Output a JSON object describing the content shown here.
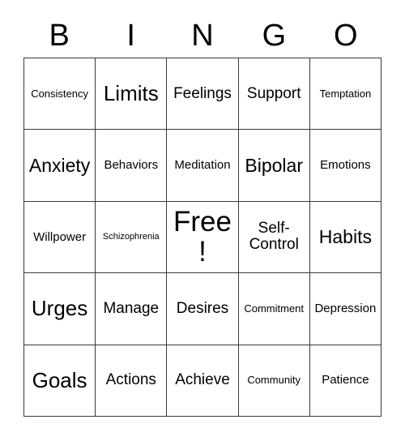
{
  "card": {
    "header_letters": [
      "B",
      "I",
      "N",
      "G",
      "O"
    ],
    "columns": 5,
    "rows": 5,
    "border_color": "#3a3a3a",
    "background_color": "#ffffff",
    "text_color": "#000000",
    "free_space": {
      "row": 3,
      "column": 3,
      "label": "Free!"
    },
    "cells": [
      {
        "text": "Consistency",
        "size": "s"
      },
      {
        "text": "Limits",
        "size": "xxl"
      },
      {
        "text": "Feelings",
        "size": "l"
      },
      {
        "text": "Support",
        "size": "l"
      },
      {
        "text": "Temptation",
        "size": "s"
      },
      {
        "text": "Anxiety",
        "size": "xl"
      },
      {
        "text": "Behaviors",
        "size": "m"
      },
      {
        "text": "Meditation",
        "size": "m"
      },
      {
        "text": "Bipolar",
        "size": "xl"
      },
      {
        "text": "Emotions",
        "size": "m"
      },
      {
        "text": "Willpower",
        "size": "m"
      },
      {
        "text": "Schizophrenia",
        "size": "xs"
      },
      {
        "text": "Free!",
        "size": "free"
      },
      {
        "text": "Self-Control",
        "size": "l"
      },
      {
        "text": "Habits",
        "size": "xl"
      },
      {
        "text": "Urges",
        "size": "xxl"
      },
      {
        "text": "Manage",
        "size": "l"
      },
      {
        "text": "Desires",
        "size": "l"
      },
      {
        "text": "Commitment",
        "size": "s"
      },
      {
        "text": "Depression",
        "size": "m"
      },
      {
        "text": "Goals",
        "size": "xxl"
      },
      {
        "text": "Actions",
        "size": "l"
      },
      {
        "text": "Achieve",
        "size": "l"
      },
      {
        "text": "Community",
        "size": "s"
      },
      {
        "text": "Patience",
        "size": "m"
      }
    ]
  }
}
